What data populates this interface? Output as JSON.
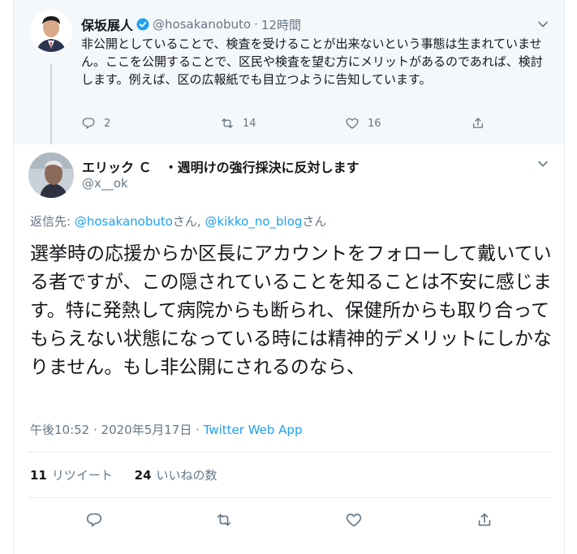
{
  "parent_tweet": {
    "author_name": "保坂展人",
    "handle": "@hosakanobuto",
    "time": "12時間",
    "text": "非公開としていることで、検査を受けることが出来ないという事態は生まれていません。ここを公開することで、区民や検査を望む方にメリットがあるのであれば、検討します。例えば、区の広報紙でも目立つように告知しています。",
    "reply_count": "2",
    "retweet_count": "14",
    "like_count": "16"
  },
  "main_tweet": {
    "author_name": "エリック Ｃ　・週明けの強行採決に反対します",
    "handle": "@x__ok",
    "replying_label": "返信先: ",
    "replying_to_1": "@hosakanobuto",
    "replying_suffix_1": "さん, ",
    "replying_to_2": "@kikko_no_blog",
    "replying_suffix_2": "さん",
    "text": "選挙時の応援からか区長にアカウントをフォローして戴いている者ですが、この隠されていることを知ることは不安に感じます。特に発熱して病院からも断られ、保健所からも取り合ってもらえない状態になっている時には精神的デメリットにしかなりません。もし非公開にされるのなら、",
    "timestamp": "午後10:52 · 2020年5月17日 · ",
    "source_app": "Twitter Web App",
    "retweets_count": "11",
    "retweets_label": "リツイート",
    "likes_count": "24",
    "likes_label": "いいねの数"
  },
  "colors": {
    "accent": "#1da1f2",
    "secondary_text": "#657786",
    "primary_text": "#14171a",
    "border": "#e6ecf0",
    "reply_bg": "#f5f8fa"
  }
}
